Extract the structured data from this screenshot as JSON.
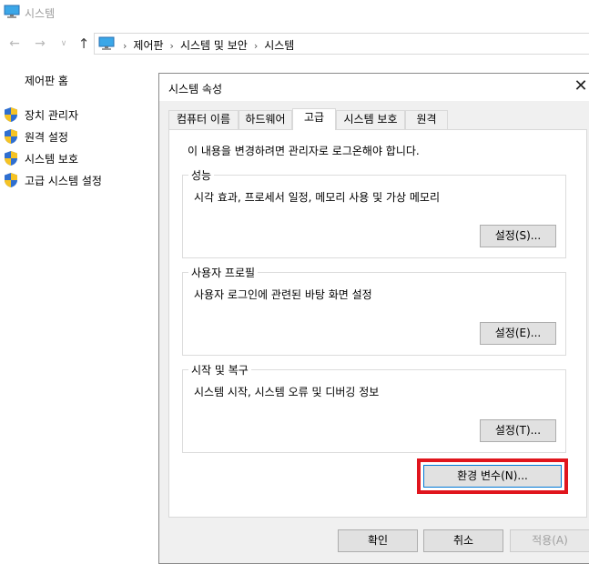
{
  "window": {
    "title": "시스템"
  },
  "address": {
    "crumbs": [
      "제어판",
      "시스템 및 보안",
      "시스템"
    ]
  },
  "sidebar": {
    "home": "제어판 홈",
    "items": [
      {
        "label": "장치 관리자"
      },
      {
        "label": "원격 설정"
      },
      {
        "label": "시스템 보호"
      },
      {
        "label": "고급 시스템 설정"
      }
    ]
  },
  "dialog": {
    "title": "시스템 속성",
    "tabs": [
      {
        "label": "컴퓨터 이름"
      },
      {
        "label": "하드웨어"
      },
      {
        "label": "고급"
      },
      {
        "label": "시스템 보호"
      },
      {
        "label": "원격"
      }
    ],
    "active_tab": "고급",
    "admin_note": "이 내용을 변경하려면 관리자로 로그온해야 합니다.",
    "groups": [
      {
        "title": "성능",
        "desc": "시각 효과, 프로세서 일정, 메모리 사용 및 가상 메모리",
        "button": "설정(S)..."
      },
      {
        "title": "사용자 프로필",
        "desc": "사용자 로그인에 관련된 바탕 화면 설정",
        "button": "설정(E)..."
      },
      {
        "title": "시작 및 복구",
        "desc": "시스템 시작, 시스템 오류 및 디버깅 정보",
        "button": "설정(T)..."
      }
    ],
    "env_button": "환경 변수(N)...",
    "footer": {
      "ok": "확인",
      "cancel": "취소",
      "apply": "적용(A)"
    }
  },
  "colors": {
    "highlight": "#e0151d",
    "dialog_bg": "#f0f0f0",
    "button_bg": "#e1e1e1",
    "focus_border": "#0078d7"
  }
}
